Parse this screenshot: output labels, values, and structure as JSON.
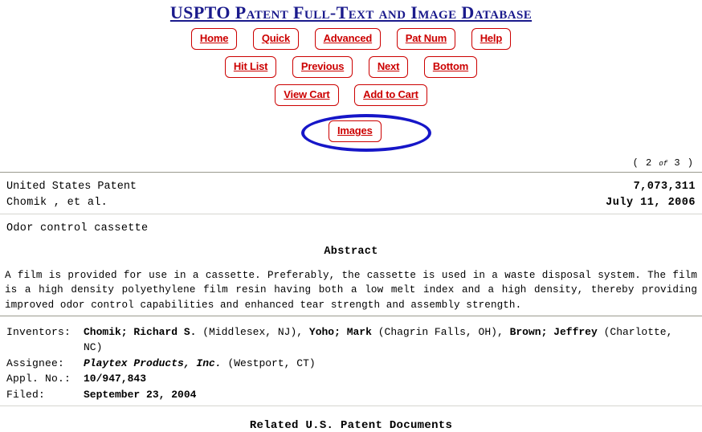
{
  "header": {
    "site_title": "USPTO Patent Full-Text and Image Database"
  },
  "nav": {
    "row1": [
      {
        "label": "Home",
        "name": "nav-home"
      },
      {
        "label": "Quick",
        "name": "nav-quick"
      },
      {
        "label": "Advanced",
        "name": "nav-advanced"
      },
      {
        "label": "Pat Num",
        "name": "nav-pat-num"
      },
      {
        "label": "Help",
        "name": "nav-help"
      }
    ],
    "row2": [
      {
        "label": "Hit List",
        "name": "nav-hit-list"
      },
      {
        "label": "Previous",
        "name": "nav-previous"
      },
      {
        "label": "Next",
        "name": "nav-next"
      },
      {
        "label": "Bottom",
        "name": "nav-bottom"
      }
    ],
    "row3": [
      {
        "label": "View Cart",
        "name": "nav-view-cart"
      },
      {
        "label": "Add to Cart",
        "name": "nav-add-to-cart"
      }
    ],
    "images_button": "Images"
  },
  "annotation": {
    "shape": "ellipse-highlight",
    "color": "#1616c8",
    "targets": "images-button"
  },
  "result_count": {
    "open_paren": "(",
    "current": "2",
    "separator": "of",
    "total": "3",
    "close_paren": ")"
  },
  "patent": {
    "authority": "United States Patent",
    "inventor_short": "Chomik ,   et al.",
    "number": "7,073,311",
    "issue_date": "July 11, 2006",
    "title": "Odor control cassette"
  },
  "abstract": {
    "heading": "Abstract",
    "text": "A film is provided for use in a cassette. Preferably, the cassette is used in a waste disposal system. The film is a high density polyethylene film resin having both a low melt index and a high density, thereby providing improved odor control capabilities and enhanced tear strength and assembly strength."
  },
  "biblio": {
    "inventors_label": "Inventors:",
    "inventors": [
      {
        "name": "Chomik; Richard S.",
        "location": "(Middlesex, NJ),"
      },
      {
        "name": "Yoho; Mark",
        "location": "(Chagrin Falls, OH),"
      },
      {
        "name": "Brown; Jeffrey",
        "location": "(Charlotte, NC)"
      }
    ],
    "assignee_label": "Assignee:",
    "assignee_name": "Playtex Products, Inc.",
    "assignee_location": "(Westport, CT)",
    "appl_no_label": "Appl. No.:",
    "appl_no_value": "10/947,843",
    "filed_label": "Filed:",
    "filed_value": "September 23, 2004"
  },
  "related": {
    "heading": "Related U.S. Patent Documents"
  },
  "colors": {
    "title_blue": "#1a1a8c",
    "button_red": "#cc0000",
    "annotation_blue": "#1616c8"
  }
}
